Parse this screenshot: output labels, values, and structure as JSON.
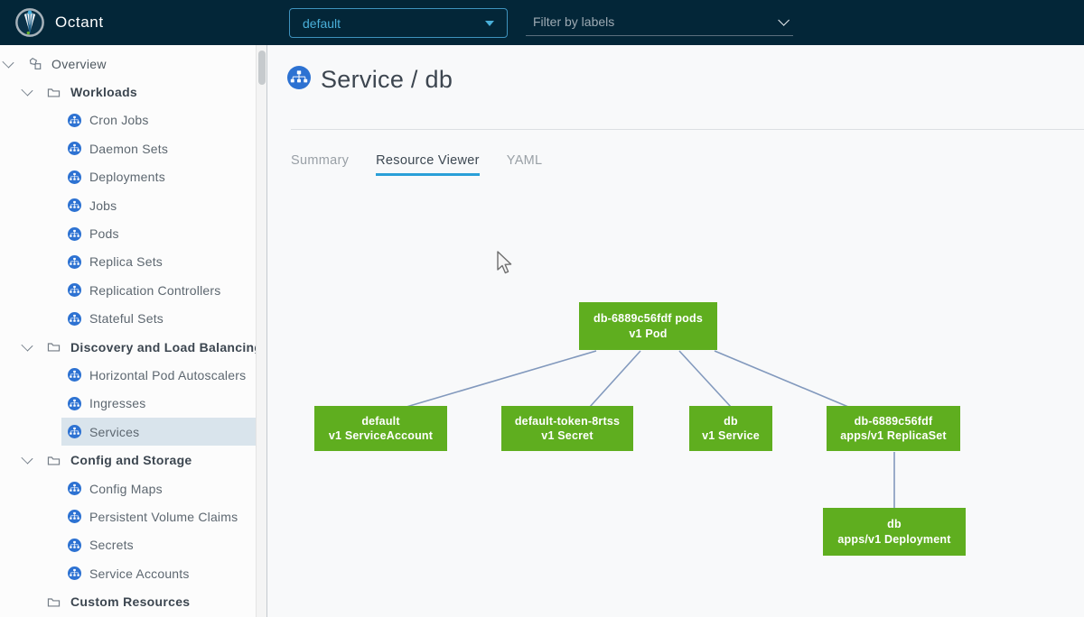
{
  "header": {
    "app_name": "Octant",
    "namespace_dropdown": {
      "value": "default"
    },
    "label_filter": {
      "placeholder": "Filter by labels"
    }
  },
  "colors": {
    "header_bg": "#032638",
    "accent_blue": "#49afd9",
    "icon_blue": "#2d72d2",
    "node_green": "#5fae1f",
    "edge_line": "#8299bd",
    "tab_underline": "#2aa0d8",
    "selected_row_bg": "#d9e4ec"
  },
  "sidebar": {
    "items": [
      {
        "label": "Overview",
        "kind": "root",
        "icon": "objects-icon",
        "expanded": true,
        "selected": false
      },
      {
        "label": "Workloads",
        "kind": "group",
        "icon": "folder-icon",
        "expanded": true,
        "selected": false
      },
      {
        "label": "Cron Jobs",
        "kind": "leaf",
        "icon": "cron-jobs-icon",
        "selected": false
      },
      {
        "label": "Daemon Sets",
        "kind": "leaf",
        "icon": "daemon-sets-icon",
        "selected": false
      },
      {
        "label": "Deployments",
        "kind": "leaf",
        "icon": "deployments-icon",
        "selected": false
      },
      {
        "label": "Jobs",
        "kind": "leaf",
        "icon": "jobs-icon",
        "selected": false
      },
      {
        "label": "Pods",
        "kind": "leaf",
        "icon": "pods-icon",
        "selected": false
      },
      {
        "label": "Replica Sets",
        "kind": "leaf",
        "icon": "replica-sets-icon",
        "selected": false
      },
      {
        "label": "Replication Controllers",
        "kind": "leaf",
        "icon": "replication-controllers-icon",
        "selected": false
      },
      {
        "label": "Stateful Sets",
        "kind": "leaf",
        "icon": "stateful-sets-icon",
        "selected": false
      },
      {
        "label": "Discovery and Load Balancing",
        "kind": "group",
        "icon": "folder-icon",
        "expanded": true,
        "selected": false
      },
      {
        "label": "Horizontal Pod Autoscalers",
        "kind": "leaf",
        "icon": "horizontal-pod-autoscalers-icon",
        "selected": false
      },
      {
        "label": "Ingresses",
        "kind": "leaf",
        "icon": "ingresses-icon",
        "selected": false
      },
      {
        "label": "Services",
        "kind": "leaf",
        "icon": "services-icon",
        "selected": true
      },
      {
        "label": "Config and Storage",
        "kind": "group",
        "icon": "folder-icon",
        "expanded": true,
        "selected": false
      },
      {
        "label": "Config Maps",
        "kind": "leaf",
        "icon": "config-maps-icon",
        "selected": false
      },
      {
        "label": "Persistent Volume Claims",
        "kind": "leaf",
        "icon": "persistent-volume-claims-icon",
        "selected": false
      },
      {
        "label": "Secrets",
        "kind": "leaf",
        "icon": "secrets-icon",
        "selected": false
      },
      {
        "label": "Service Accounts",
        "kind": "leaf",
        "icon": "service-accounts-icon",
        "selected": false
      },
      {
        "label": "Custom Resources",
        "kind": "group",
        "icon": "folder-icon",
        "selected": false
      }
    ]
  },
  "main": {
    "title": "Service / db",
    "tabs": [
      {
        "label": "Summary",
        "active": false
      },
      {
        "label": "Resource Viewer",
        "active": true
      },
      {
        "label": "YAML",
        "active": false
      }
    ]
  },
  "graph": {
    "nodes": [
      {
        "id": "pod",
        "name": "db-6889c56fdf pods",
        "kind": "v1 Pod"
      },
      {
        "id": "serviceaccount",
        "name": "default",
        "kind": "v1 ServiceAccount"
      },
      {
        "id": "secret",
        "name": "default-token-8rtss",
        "kind": "v1 Secret"
      },
      {
        "id": "service",
        "name": "db",
        "kind": "v1 Service"
      },
      {
        "id": "replicaset",
        "name": "db-6889c56fdf",
        "kind": "apps/v1 ReplicaSet"
      },
      {
        "id": "deployment",
        "name": "db",
        "kind": "apps/v1 Deployment"
      }
    ],
    "edges": [
      {
        "from": "pod",
        "to": "serviceaccount"
      },
      {
        "from": "pod",
        "to": "secret"
      },
      {
        "from": "pod",
        "to": "service"
      },
      {
        "from": "pod",
        "to": "replicaset"
      },
      {
        "from": "replicaset",
        "to": "deployment"
      }
    ]
  }
}
